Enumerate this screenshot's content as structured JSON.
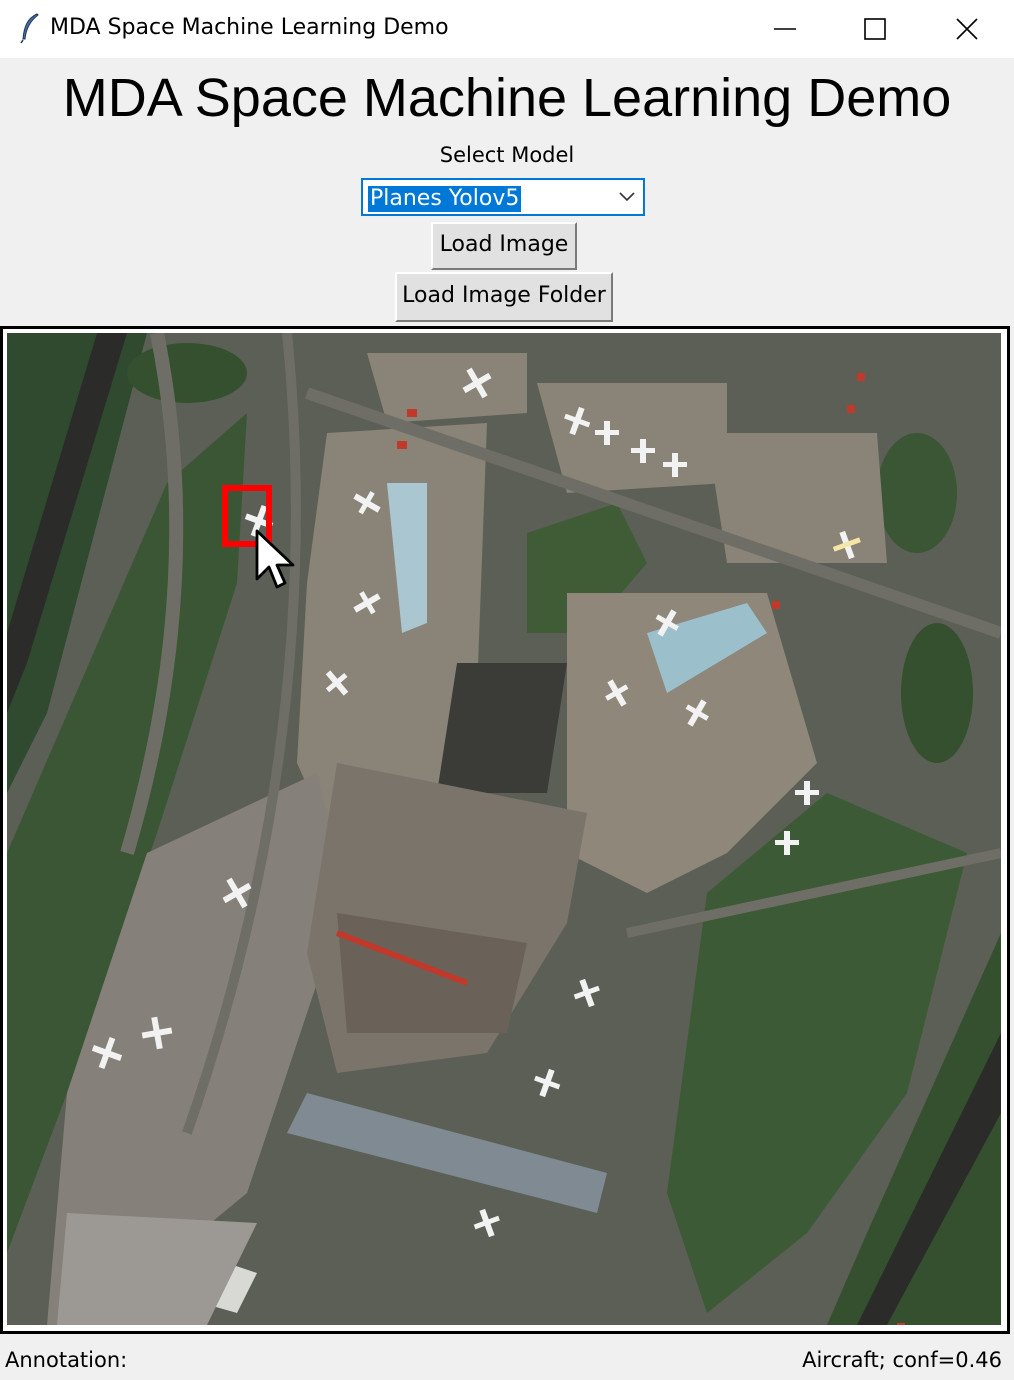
{
  "window": {
    "title": "MDA Space Machine Learning Demo",
    "icon": "feather-icon",
    "controls": [
      "minimize-icon",
      "maximize-icon",
      "close-icon"
    ]
  },
  "heading": "MDA Space Machine Learning Demo",
  "model_select": {
    "label": "Select Model",
    "value": "Planes Yolov5"
  },
  "buttons": {
    "load_image": "Load Image",
    "load_folder": "Load Image Folder"
  },
  "image_view": {
    "content": "aerial airport imagery",
    "detection_box_color": "#ff0000"
  },
  "status": {
    "annotation_label": "Annotation:",
    "detection": "Aircraft; conf=0.46"
  },
  "colors": {
    "accent": "#0078d7",
    "window_bg": "#f0f0f0"
  }
}
